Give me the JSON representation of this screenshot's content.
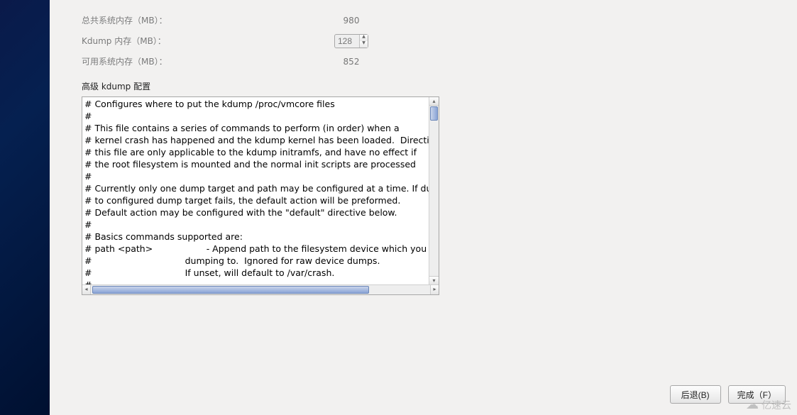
{
  "memory": {
    "total_label": "总共系统内存（MB）：",
    "total_value": "980",
    "kdump_label": "Kdump 内存（MB）：",
    "kdump_value": "128",
    "usable_label": "可用系统内存（MB）：",
    "usable_value": "852"
  },
  "section_advanced_title": "高级 kdump 配置",
  "config_text": "# Configures where to put the kdump /proc/vmcore files\n#\n# This file contains a series of commands to perform (in order) when a\n# kernel crash has happened and the kdump kernel has been loaded.  Directives in\n# this file are only applicable to the kdump initramfs, and have no effect if\n# the root filesystem is mounted and the normal init scripts are processed\n#\n# Currently only one dump target and path may be configured at a time. If dumping\n# to configured dump target fails, the default action will be preformed.\n# Default action may be configured with the \"default\" directive below.\n#\n# Basics commands supported are:\n# path <path>                   - Append path to the filesystem device which you are\n#                                 dumping to.  Ignored for raw device dumps.\n#                                 If unset, will default to /var/crash.\n#\n# core_collector <command> <options>",
  "buttons": {
    "back": "后退(B)",
    "finish": "完成（F）"
  },
  "watermark": "亿速云"
}
